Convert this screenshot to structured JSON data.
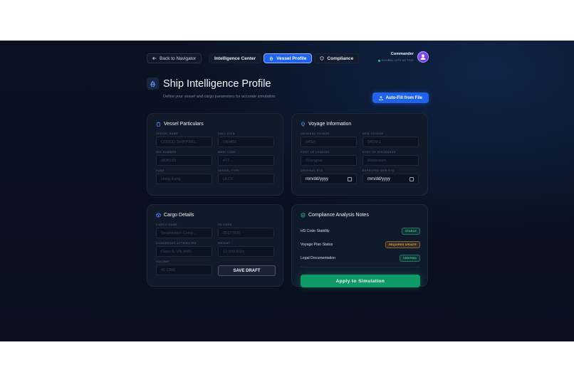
{
  "nav": {
    "back_label": "Back to Navigator",
    "tabs": [
      {
        "label": "Intelligence Center"
      },
      {
        "label": "Vessel Profile"
      },
      {
        "label": "Compliance"
      }
    ]
  },
  "user": {
    "name": "Commander",
    "status": "GLOBAL GPS ACTIVE"
  },
  "header": {
    "title": "Ship Intelligence Profile",
    "subtitle": "Define your vessel and cargo parameters for accurate simulation",
    "autofill_label": "Auto-Fill from File"
  },
  "vessel": {
    "title": "Vessel Particulars",
    "fields": [
      {
        "label": "VESSEL NAME",
        "placeholder": "COSCO SHIPPING..."
      },
      {
        "label": "CALL SIGN",
        "placeholder": "VRMB2"
      },
      {
        "label": "IMO NUMBER",
        "placeholder": "9826183"
      },
      {
        "label": "MMSI CODE",
        "placeholder": "477..."
      },
      {
        "label": "FLAG",
        "placeholder": "Hong Kong"
      },
      {
        "label": "VESSEL TYPE",
        "placeholder": "ULCV"
      }
    ]
  },
  "voyage": {
    "title": "Voyage Information",
    "fields": [
      {
        "label": "ORIGINAL VOYAGE",
        "placeholder": "045W"
      },
      {
        "label": "NEW VOYAGE",
        "placeholder": "045W-1"
      },
      {
        "label": "PORT OF LOADING",
        "placeholder": "Shanghai"
      },
      {
        "label": "PORT OF DISCHARGE",
        "placeholder": "Rotterdam"
      },
      {
        "label": "ORIGINAL ETA",
        "placeholder": "mm/dd/yyyy"
      },
      {
        "label": "EXPECTED NEW ETA",
        "placeholder": "mm/dd/yyyy"
      }
    ]
  },
  "cargo": {
    "title": "Cargo Details",
    "fields": [
      {
        "label": "CARGO NAME",
        "placeholder": "Smartwatch Comp..."
      },
      {
        "label": "HS CODE",
        "placeholder": "85177900"
      },
      {
        "label": "DANGEROUS ATTRIBUTES",
        "placeholder": "Class 9, UN 3481"
      },
      {
        "label": "WEIGHT",
        "placeholder": "12,500 KGS"
      },
      {
        "label": "VOLUME",
        "placeholder": "45 CBM"
      }
    ],
    "draft_label": "SAVE DRAFT"
  },
  "notes": {
    "title": "Compliance Analysis Notes",
    "rows": [
      {
        "label": "HS Code Stability",
        "badge": "STABLE"
      },
      {
        "label": "Voyage Plan Status",
        "badge": "REQUIRES UPDATE"
      },
      {
        "label": "Legal Documentation",
        "badge": "VERIFIED"
      }
    ],
    "apply_label": "Apply to Simulation"
  },
  "colors": {
    "accent": "#1f63ea",
    "success": "#0e9a66",
    "warning": "#f3a84a",
    "background": "#0b1222"
  }
}
